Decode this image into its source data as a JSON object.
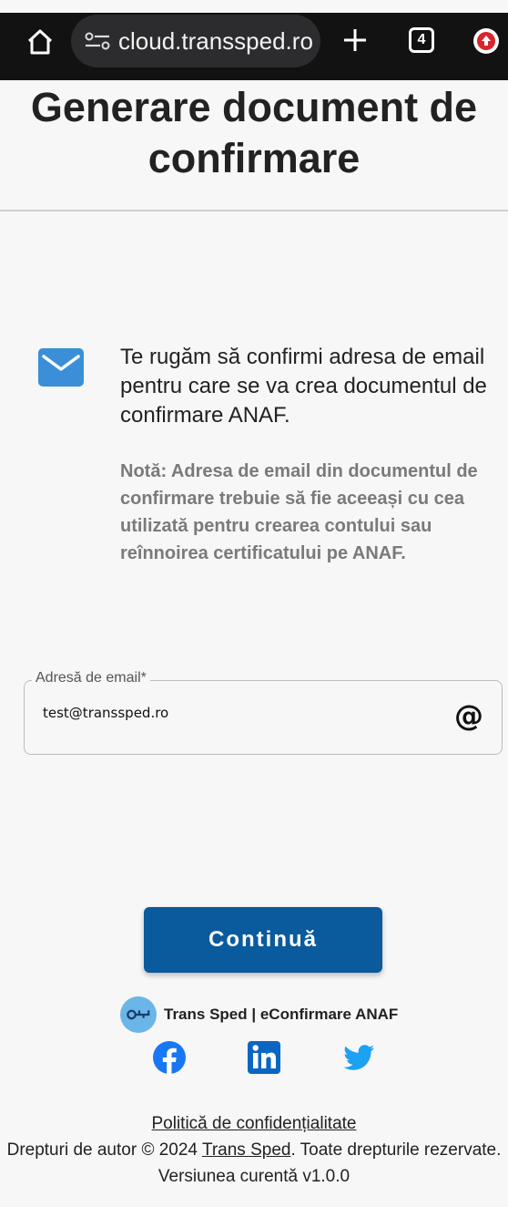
{
  "browser": {
    "url": "cloud.transsped.ro",
    "tab_count": "4"
  },
  "page": {
    "title": "Generare document de confirmare"
  },
  "info": {
    "message": "Te rugăm să confirmi adresa de email pentru care se va crea documentul de confirmare ANAF.",
    "note": "Notă: Adresa de email din documentul de confirmare trebuie să fie aceeași cu cea utilizată pentru crearea contului sau reînnoirea certificatului pe ANAF."
  },
  "email_field": {
    "label": "Adresă de email*",
    "value": "test@transsped.ro"
  },
  "actions": {
    "continue_label": "Continuă"
  },
  "brand": {
    "text": "Trans Sped | eConfirmare ANAF"
  },
  "social": {
    "items": [
      "facebook-icon",
      "linkedin-icon",
      "twitter-icon"
    ]
  },
  "footer": {
    "privacy_link": "Politică de confidențialitate",
    "copyright_prefix": "Drepturi de autor © 2024 ",
    "company_link": "Trans Sped",
    "copyright_suffix": ". Toate drepturile rezervate.",
    "version": "Versiunea curentă v1.0.0"
  },
  "colors": {
    "primary": "#0a5a9e",
    "mail_icon": "#3a8fd8",
    "facebook": "#1877f2",
    "linkedin": "#0a66c2",
    "twitter": "#1da1f2"
  }
}
